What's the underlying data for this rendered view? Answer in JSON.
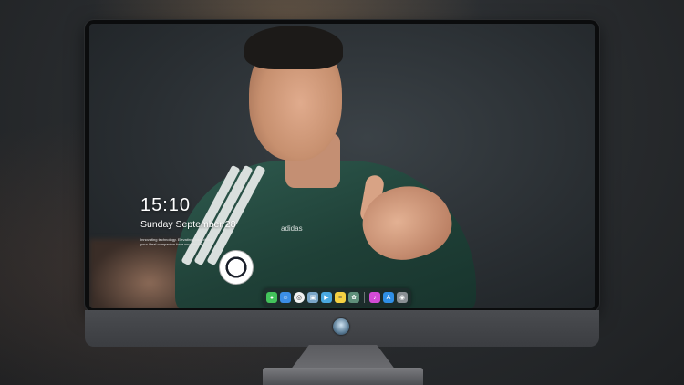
{
  "lockscreen": {
    "time": "15:10",
    "date": "Sunday September 28",
    "caption_line1": "Innovating technology. Elevating possibilities.",
    "caption_line2": "your ideal companion for a smarter life."
  },
  "photo": {
    "jersey_brand": "adidas"
  },
  "dock": {
    "icons": [
      {
        "name": "messages-icon",
        "color": "#43c35b"
      },
      {
        "name": "finder-icon",
        "color": "#3b8ee6"
      },
      {
        "name": "safari-icon",
        "color": "#f2f2f2"
      },
      {
        "name": "preview-icon",
        "color": "#7aa6c8"
      },
      {
        "name": "clapper-icon",
        "color": "#4aa9e0"
      },
      {
        "name": "notes-icon",
        "color": "#f5d142"
      },
      {
        "name": "photos-icon",
        "color": "#5f8f7a"
      },
      {
        "name": "music-icon",
        "color": "#d24bd6"
      },
      {
        "name": "appstore-icon",
        "color": "#2f8fe6"
      },
      {
        "name": "camera-icon",
        "color": "#8a8f94"
      }
    ]
  },
  "monitor": {
    "logo_icon": "brand-logo-icon"
  }
}
